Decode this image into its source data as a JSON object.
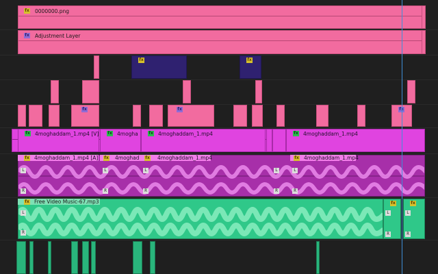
{
  "tracks": {
    "v_top": {
      "clip_label": "0000000.png",
      "fx": "fx"
    },
    "v_adjust": {
      "clip_label": "Adjustment Layer",
      "fx": "fx"
    },
    "v_navy": {
      "fx": "fx"
    },
    "v_main": {
      "clips": [
        {
          "label": "4moghaddam_1.mp4 [V]"
        },
        {
          "label": "4mogha"
        },
        {
          "label": "4moghaddam_1.mp4"
        },
        {
          "label": "4moghaddam_1.mp4"
        }
      ]
    },
    "a_main": {
      "clips": [
        {
          "label": "4moghaddam_1.mp4 [A]"
        },
        {
          "label": "4moghad"
        },
        {
          "label": "4moghaddam_1.mp4"
        },
        {
          "label": "4moghaddam_1.mp4"
        }
      ],
      "channel_left": "L",
      "channel_right": "R"
    },
    "a_music": {
      "clip_label": "Free Video Music-67.mp3",
      "channel_left": "L",
      "channel_right": "R"
    }
  },
  "colors": {
    "pink": "#f26b9f",
    "navy": "#2f2170",
    "magenta": "#e044e0",
    "video_audio": "#a72fa9",
    "music_audio": "#2fc889",
    "playhead": "#3f8fd8"
  }
}
